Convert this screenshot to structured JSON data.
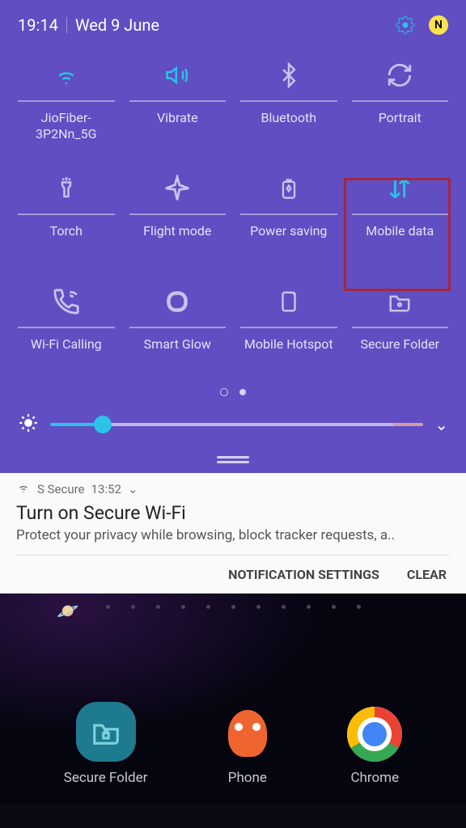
{
  "status": {
    "time": "19:14",
    "date": "Wed 9 June",
    "badge": "N"
  },
  "tiles": [
    {
      "id": "wifi",
      "label": "JioFiber-3P2Nn_5G",
      "active": true
    },
    {
      "id": "vibrate",
      "label": "Vibrate",
      "active": true
    },
    {
      "id": "bluetooth",
      "label": "Bluetooth",
      "active": false
    },
    {
      "id": "portrait",
      "label": "Portrait",
      "active": false
    },
    {
      "id": "torch",
      "label": "Torch",
      "active": false
    },
    {
      "id": "flight",
      "label": "Flight mode",
      "active": false
    },
    {
      "id": "power",
      "label": "Power saving",
      "active": false
    },
    {
      "id": "mobiledata",
      "label": "Mobile data",
      "active": true,
      "highlighted": true
    },
    {
      "id": "wificall",
      "label": "Wi-Fi Calling",
      "active": false
    },
    {
      "id": "smartglow",
      "label": "Smart Glow",
      "active": false
    },
    {
      "id": "hotspot",
      "label": "Mobile Hotspot",
      "active": false
    },
    {
      "id": "securefolder",
      "label": "Secure Folder",
      "active": false
    }
  ],
  "notification": {
    "app": "S Secure",
    "time": "13:52",
    "title": "Turn on Secure Wi-Fi",
    "body": "Protect your privacy while browsing, block tracker requests, a..",
    "action_settings": "NOTIFICATION SETTINGS",
    "action_clear": "CLEAR"
  },
  "home_apps": {
    "secure": "Secure Folder",
    "phone": "Phone",
    "chrome": "Chrome"
  }
}
